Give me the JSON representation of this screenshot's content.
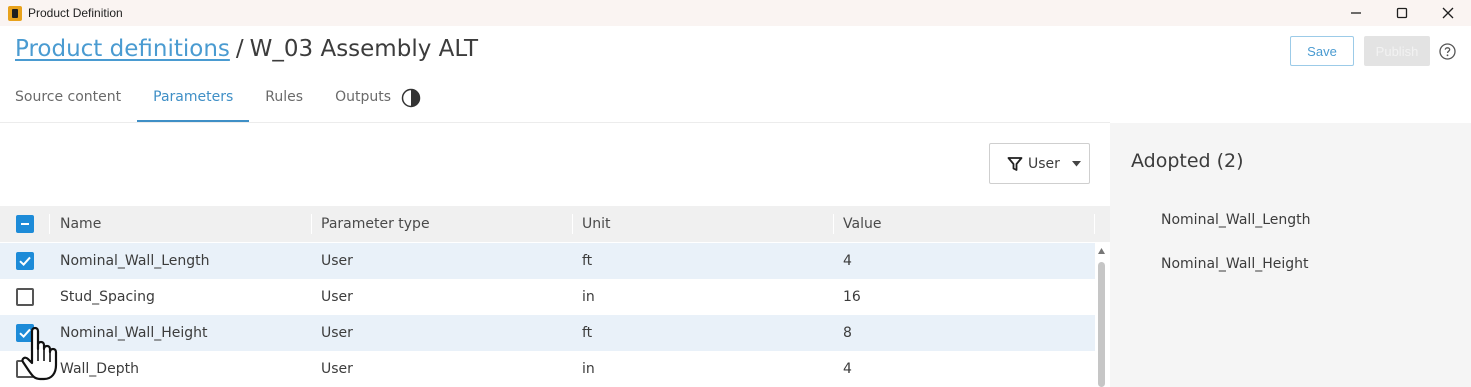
{
  "window": {
    "title": "Product Definition"
  },
  "header": {
    "breadcrumb_link": "Product definitions",
    "breadcrumb_sep": "/",
    "breadcrumb_current": "W_03 Assembly ALT",
    "save_label": "Save",
    "publish_label": "Publish"
  },
  "tabs": [
    {
      "label": "Source content",
      "active": false
    },
    {
      "label": "Parameters",
      "active": true
    },
    {
      "label": "Rules",
      "active": false
    },
    {
      "label": "Outputs",
      "active": false
    }
  ],
  "filter": {
    "label": "User"
  },
  "table": {
    "columns": [
      "Name",
      "Parameter type",
      "Unit",
      "Value"
    ],
    "header_checkbox_state": "indeterminate",
    "rows": [
      {
        "checked": true,
        "name": "Nominal_Wall_Length",
        "type": "User",
        "unit": "ft",
        "value": "4"
      },
      {
        "checked": false,
        "name": "Stud_Spacing",
        "type": "User",
        "unit": "in",
        "value": "16"
      },
      {
        "checked": true,
        "name": "Nominal_Wall_Height",
        "type": "User",
        "unit": "ft",
        "value": "8"
      },
      {
        "checked": false,
        "name": "Wall_Depth",
        "type": "User",
        "unit": "in",
        "value": "4"
      }
    ]
  },
  "adopted": {
    "title": "Adopted (2)",
    "items": [
      "Nominal_Wall_Length",
      "Nominal_Wall_Height"
    ]
  },
  "colors": {
    "accent": "#1d8bd8",
    "link": "#4a9bd1",
    "selected_row": "#e9f1f9"
  }
}
